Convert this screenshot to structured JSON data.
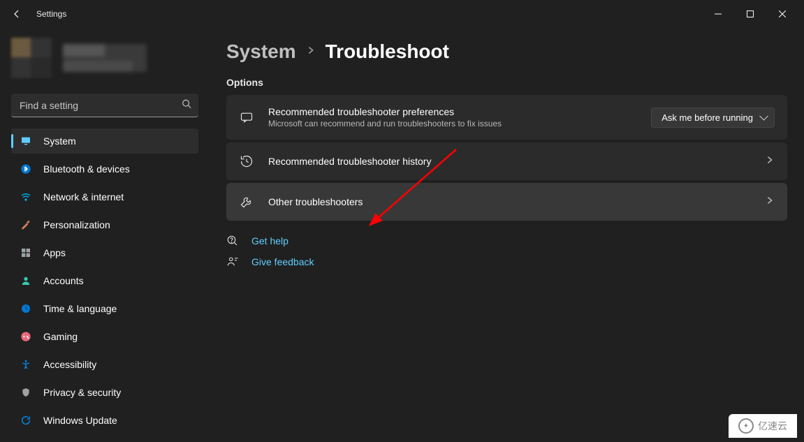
{
  "window": {
    "title": "Settings"
  },
  "search": {
    "placeholder": "Find a setting"
  },
  "sidebar": {
    "items": [
      {
        "label": "System",
        "icon": "monitor",
        "color": "#60cdff"
      },
      {
        "label": "Bluetooth & devices",
        "icon": "bluetooth",
        "color": "#0078d4"
      },
      {
        "label": "Network & internet",
        "icon": "wifi",
        "color": "#00b7ff"
      },
      {
        "label": "Personalization",
        "icon": "brush",
        "color": "#d08060"
      },
      {
        "label": "Apps",
        "icon": "apps",
        "color": "#9ea2a4"
      },
      {
        "label": "Accounts",
        "icon": "person",
        "color": "#34c9b1"
      },
      {
        "label": "Time & language",
        "icon": "clock",
        "color": "#0078d4"
      },
      {
        "label": "Gaming",
        "icon": "gaming",
        "color": "#e8687a"
      },
      {
        "label": "Accessibility",
        "icon": "accessibility",
        "color": "#0091ff"
      },
      {
        "label": "Privacy & security",
        "icon": "shield",
        "color": "#9ea2a4"
      },
      {
        "label": "Windows Update",
        "icon": "update",
        "color": "#0091ff"
      }
    ]
  },
  "breadcrumb": {
    "root": "System",
    "current": "Troubleshoot"
  },
  "section": {
    "label": "Options"
  },
  "cards": {
    "prefs": {
      "title": "Recommended troubleshooter preferences",
      "subtitle": "Microsoft can recommend and run troubleshooters to fix issues",
      "dropdown_value": "Ask me before running"
    },
    "history": {
      "title": "Recommended troubleshooter history"
    },
    "other": {
      "title": "Other troubleshooters"
    }
  },
  "help": {
    "get_help": "Get help",
    "feedback": "Give feedback"
  },
  "watermark": "亿速云"
}
